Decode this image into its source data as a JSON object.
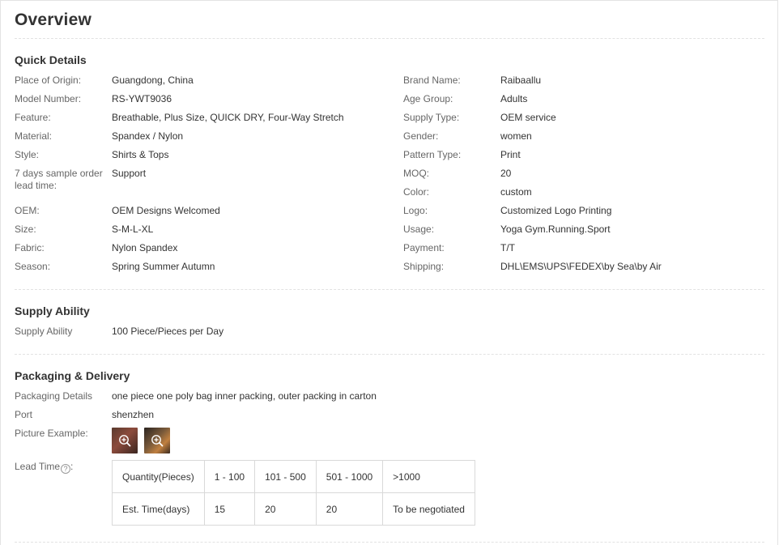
{
  "title": "Overview",
  "quick_details": {
    "heading": "Quick Details",
    "left": [
      {
        "label": "Place of Origin:",
        "value": "Guangdong, China"
      },
      {
        "label": "Model Number:",
        "value": "RS-YWT9036"
      },
      {
        "label": "Feature:",
        "value": "Breathable, Plus Size, QUICK DRY, Four-Way Stretch"
      },
      {
        "label": "Material:",
        "value": "Spandex / Nylon"
      },
      {
        "label": "Style:",
        "value": "Shirts & Tops"
      },
      {
        "label": "7 days sample order lead time:",
        "value": "Support"
      },
      {
        "label": "OEM:",
        "value": "OEM Designs Welcomed"
      },
      {
        "label": "Size:",
        "value": "S-M-L-XL"
      },
      {
        "label": "Fabric:",
        "value": "Nylon Spandex"
      },
      {
        "label": "Season:",
        "value": "Spring Summer Autumn"
      }
    ],
    "right": [
      {
        "label": "Brand Name:",
        "value": "Raibaallu"
      },
      {
        "label": "Age Group:",
        "value": "Adults"
      },
      {
        "label": "Supply Type:",
        "value": "OEM service"
      },
      {
        "label": "Gender:",
        "value": "women"
      },
      {
        "label": "Pattern Type:",
        "value": "Print"
      },
      {
        "label": "MOQ:",
        "value": "20"
      },
      {
        "label": "Color:",
        "value": "custom"
      },
      {
        "label": "Logo:",
        "value": "Customized Logo Printing"
      },
      {
        "label": "Usage:",
        "value": "Yoga Gym.Running.Sport"
      },
      {
        "label": "Payment:",
        "value": "T/T"
      },
      {
        "label": "Shipping:",
        "value": "DHL\\EMS\\UPS\\FEDEX\\by Sea\\by Air"
      }
    ]
  },
  "supply_ability": {
    "heading": "Supply Ability",
    "label": "Supply Ability",
    "value": "100 Piece/Pieces per Day"
  },
  "packaging": {
    "heading": "Packaging & Delivery",
    "details_label": "Packaging Details",
    "details_value": "one piece one poly bag inner packing, outer packing in carton",
    "port_label": "Port",
    "port_value": "shenzhen",
    "picture_label": "Picture Example:",
    "lead_time_label": "Lead Time",
    "lead_time_suffix": ":",
    "help_glyph": "?",
    "lead_table": {
      "header": [
        "Quantity(Pieces)",
        "1 - 100",
        "101 - 500",
        "501 - 1000",
        ">1000"
      ],
      "row": [
        "Est. Time(days)",
        "15",
        "20",
        "20",
        "To be negotiated"
      ]
    }
  },
  "colors": {
    "label": "#666666",
    "value": "#333333",
    "divider": "#e2e2e2",
    "table_border": "#d9d9d9"
  }
}
